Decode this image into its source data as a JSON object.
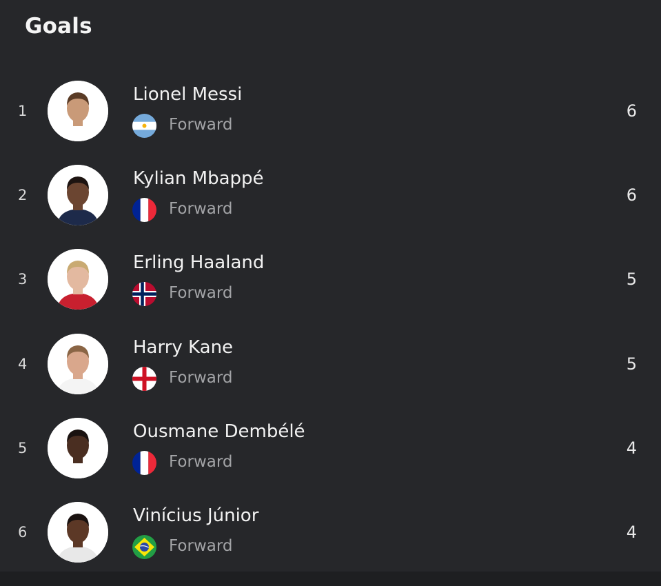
{
  "header": {
    "title": "Goals"
  },
  "players": [
    {
      "rank": "1",
      "name": "Lionel Messi",
      "position": "Forward",
      "value": "6",
      "flag_icon": "argentina-flag-icon",
      "skin": "#c99a78",
      "hair": "#5a3b26",
      "shirt": "#ffffff"
    },
    {
      "rank": "2",
      "name": "Kylian Mbappé",
      "position": "Forward",
      "value": "6",
      "flag_icon": "france-flag-icon",
      "skin": "#6b4531",
      "hair": "#1d1411",
      "shirt": "#1d2a4a"
    },
    {
      "rank": "3",
      "name": "Erling Haaland",
      "position": "Forward",
      "value": "5",
      "flag_icon": "norway-flag-icon",
      "skin": "#e3b9a0",
      "hair": "#c9aa72",
      "shirt": "#c8202f"
    },
    {
      "rank": "4",
      "name": "Harry Kane",
      "position": "Forward",
      "value": "5",
      "flag_icon": "england-flag-icon",
      "skin": "#d9a78c",
      "hair": "#8a6545",
      "shirt": "#f4f4f4"
    },
    {
      "rank": "5",
      "name": "Ousmane Dembélé",
      "position": "Forward",
      "value": "4",
      "flag_icon": "france-flag-icon",
      "skin": "#4a2e21",
      "hair": "#1a1210",
      "shirt": "#ffffff"
    },
    {
      "rank": "6",
      "name": "Vinícius Júnior",
      "position": "Forward",
      "value": "4",
      "flag_icon": "brazil-flag-icon",
      "skin": "#5c3826",
      "hair": "#1a1210",
      "shirt": "#e8e8e8"
    }
  ],
  "colors": {
    "background": "#26272a",
    "text_primary": "#f2f2f2",
    "text_secondary": "#a3a4a7"
  }
}
